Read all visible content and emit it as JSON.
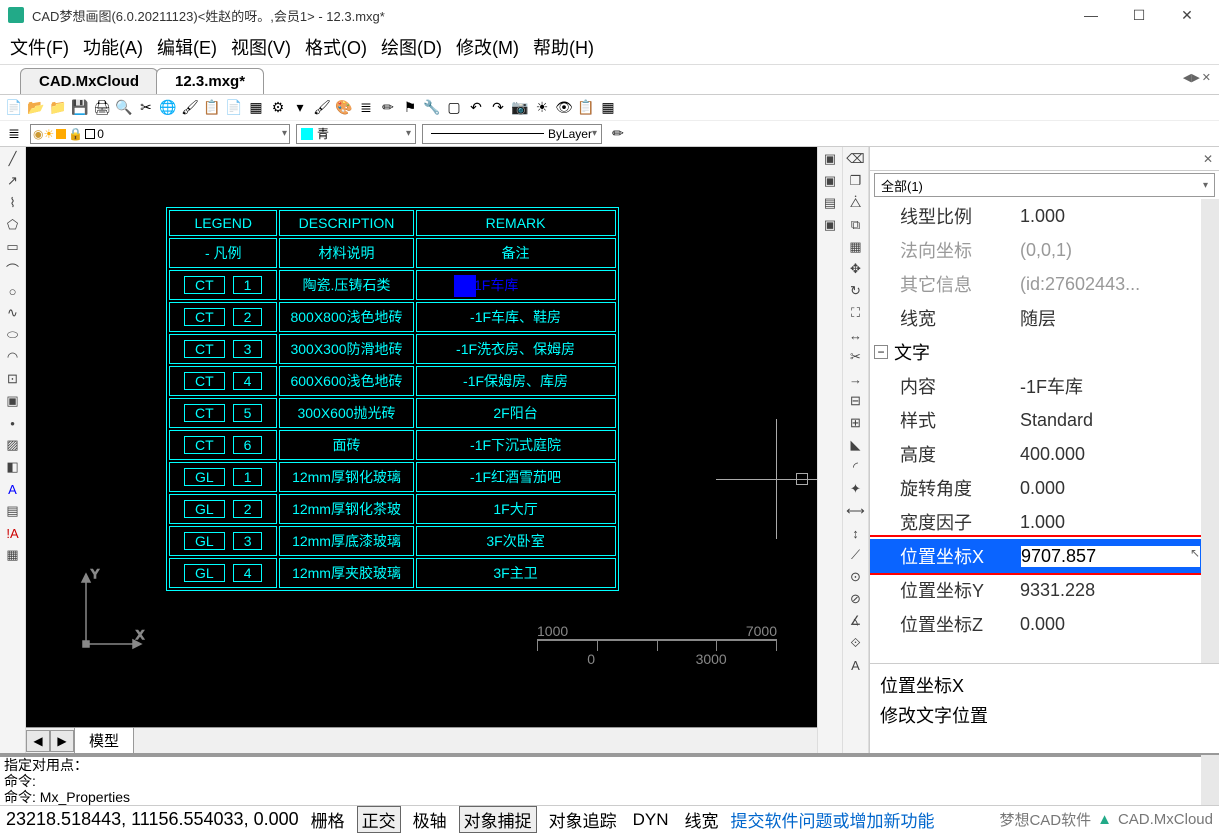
{
  "title_bar": "CAD梦想画图(6.0.20211123)<姓赵的呀。,会员1> - 12.3.mxg*",
  "menu": [
    "文件(F)",
    "功能(A)",
    "编辑(E)",
    "视图(V)",
    "格式(O)",
    "绘图(D)",
    "修改(M)",
    "帮助(H)"
  ],
  "tabs": {
    "inactive": "CAD.MxCloud",
    "active": "12.3.mxg*"
  },
  "layer_combo": "0",
  "color_combo": "青",
  "ltype_combo": "ByLayer",
  "cad_table": {
    "headers": [
      {
        "col1": "LEGEND",
        "col2": "DESCRIPTION",
        "col3": "REMARK"
      },
      {
        "col1": "- 凡例",
        "col2": "材料说明",
        "col3": "备注"
      }
    ],
    "rows": [
      {
        "code": "CT",
        "num": "1",
        "desc": "陶瓷.压铸石类",
        "remark": ""
      },
      {
        "code": "CT",
        "num": "2",
        "desc": "800X800浅色地砖",
        "remark": "-1F车库、鞋房"
      },
      {
        "code": "CT",
        "num": "3",
        "desc": "300X300防滑地砖",
        "remark": "-1F洗衣房、保姆房"
      },
      {
        "code": "CT",
        "num": "4",
        "desc": "600X600浅色地砖",
        "remark": "-1F保姆房、库房"
      },
      {
        "code": "CT",
        "num": "5",
        "desc": "300X600抛光砖",
        "remark": "2F阳台"
      },
      {
        "code": "CT",
        "num": "6",
        "desc": "面砖",
        "remark": "-1F下沉式庭院"
      },
      {
        "code": "GL",
        "num": "1",
        "desc": "12mm厚钢化玻璃",
        "remark": "-1F红酒雪茄吧"
      },
      {
        "code": "GL",
        "num": "2",
        "desc": "12mm厚钢化茶玻",
        "remark": "1F大厅"
      },
      {
        "code": "GL",
        "num": "3",
        "desc": "12mm厚底漆玻璃",
        "remark": "3F次卧室"
      },
      {
        "code": "GL",
        "num": "4",
        "desc": "12mm厚夹胶玻璃",
        "remark": "3F主卫"
      }
    ],
    "selected_text": "1F车库"
  },
  "ruler": {
    "top_left": "1000",
    "top_right": "7000",
    "bot_left": "0",
    "bot_right": "3000"
  },
  "model_tab": "模型",
  "props": {
    "filter": "全部(1)",
    "rows": [
      {
        "label": "线型比例",
        "value": "1.000",
        "grey": false
      },
      {
        "label": "法向坐标",
        "value": "(0,0,1)",
        "grey": true
      },
      {
        "label": "其它信息",
        "value": "(id:27602443...",
        "grey": true
      },
      {
        "label": "线宽",
        "value": "随层",
        "grey": false
      }
    ],
    "section": "文字",
    "rows2": [
      {
        "label": "内容",
        "value": "-1F车库"
      },
      {
        "label": "样式",
        "value": "Standard"
      },
      {
        "label": "高度",
        "value": "400.000"
      },
      {
        "label": "旋转角度",
        "value": "0.000"
      },
      {
        "label": "宽度因子",
        "value": "1.000"
      },
      {
        "label": "位置坐标X",
        "value": "9707.857",
        "selected": true
      },
      {
        "label": "位置坐标Y",
        "value": "9331.228"
      },
      {
        "label": "位置坐标Z",
        "value": "0.000"
      }
    ],
    "desc_title": "位置坐标X",
    "desc_body": "修改文字位置"
  },
  "cmd": {
    "line1": "指定对用点：",
    "line2": "命令:",
    "line3": "命令: Mx_Properties"
  },
  "status": {
    "coords": "23218.518443, 11156.554033, 0.000",
    "btns": [
      "栅格",
      "正交",
      "极轴",
      "对象捕捉",
      "对象追踪",
      "DYN",
      "线宽"
    ],
    "link": "提交软件问题或增加新功能",
    "right": "梦想CAD软件",
    "brand": "CAD.MxCloud"
  }
}
